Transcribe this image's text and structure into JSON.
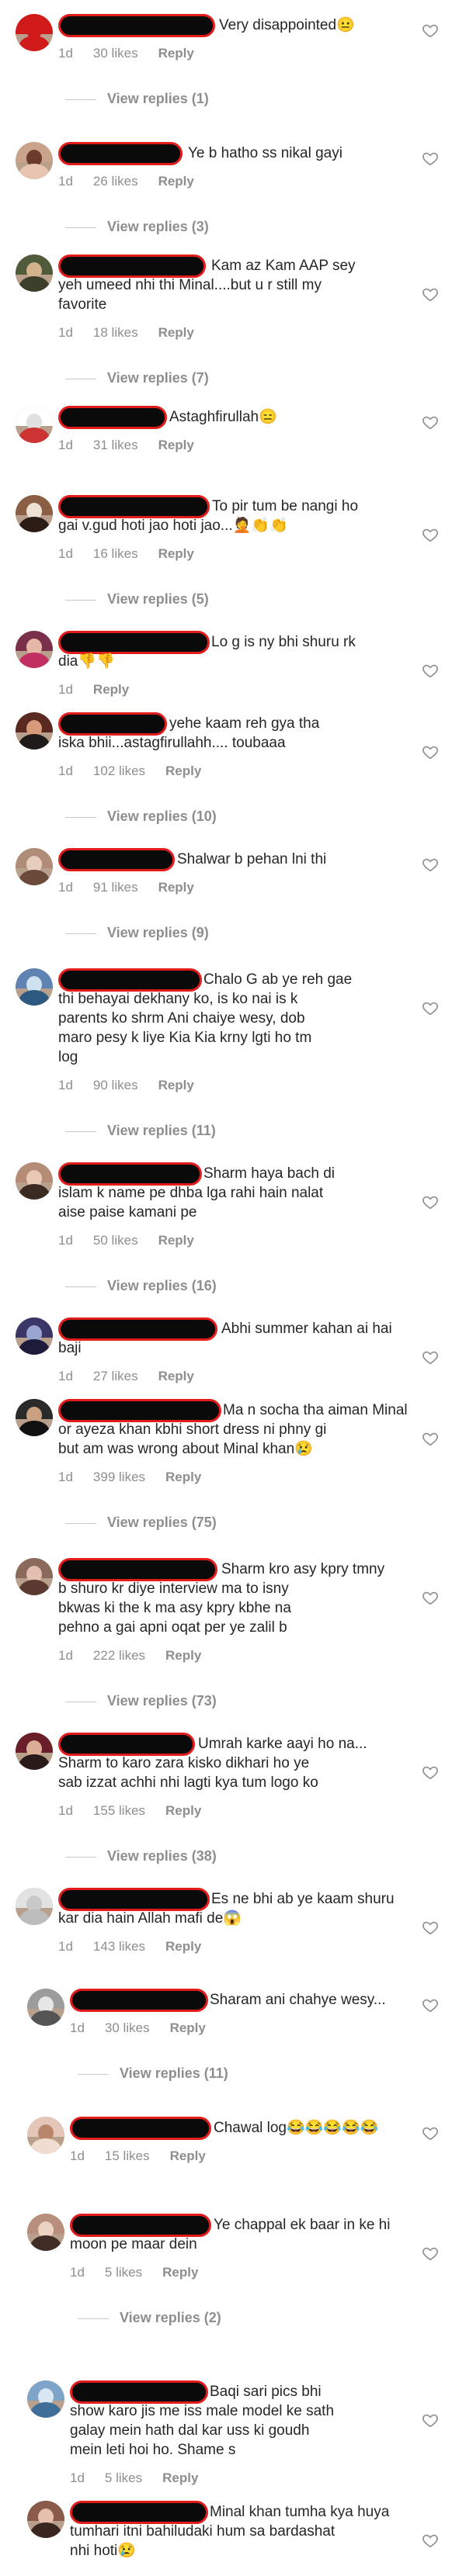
{
  "comments": [
    {
      "text": "Very disappointed",
      "time": "1d",
      "likes": "30 likes",
      "reply": "Reply",
      "view_replies": "View replies (1)",
      "emoji": "😐"
    },
    {
      "text": "Ye b hatho ss nikal gayi",
      "time": "1d",
      "likes": "26 likes",
      "reply": "Reply",
      "view_replies": "View replies (3)"
    },
    {
      "text": "Kam az Kam AAP sey\nyeh umeed nhi thi Minal....but u r still my\nfavorite",
      "time": "1d",
      "likes": "18 likes",
      "reply": "Reply",
      "view_replies": "View replies (7)"
    },
    {
      "text": "Astaghfirullah",
      "time": "1d",
      "likes": "31 likes",
      "reply": "Reply",
      "emoji": "😑"
    },
    {
      "text": "To pir tum be nangi ho\ngai v.gud hoti jao hoti jao...",
      "time": "1d",
      "likes": "16 likes",
      "reply": "Reply",
      "view_replies": "View replies (5)",
      "emoji": "🤦👏👏"
    },
    {
      "text": "Lo g is ny bhi shuru rk\ndia",
      "time": "1d",
      "likes": "",
      "reply": "Reply",
      "emoji": "👎👎"
    },
    {
      "text": "yehe kaam reh gya tha\niska bhii...astagfirullahh.... toubaaa",
      "time": "1d",
      "likes": "102 likes",
      "reply": "Reply",
      "view_replies": "View replies (10)"
    },
    {
      "text": "Shalwar b pehan lni thi",
      "time": "1d",
      "likes": "91 likes",
      "reply": "Reply",
      "view_replies": "View replies (9)"
    },
    {
      "text": "Chalo G ab ye reh gae\nthi behayai dekhany ko, is ko nai is k\nparents ko shrm Ani chaiye wesy, dob\nmaro pesy k liye Kia Kia krny lgti ho tm\nlog",
      "time": "1d",
      "likes": "90 likes",
      "reply": "Reply",
      "view_replies": "View replies (11)"
    },
    {
      "text": "Sharm haya bach di\nislam k name pe dhba lga rahi hain nalat\naise paise kamani pe",
      "time": "1d",
      "likes": "50 likes",
      "reply": "Reply",
      "view_replies": "View replies (16)"
    },
    {
      "text": "Abhi summer kahan ai hai\nbaji",
      "time": "1d",
      "likes": "27 likes",
      "reply": "Reply"
    },
    {
      "text": "Ma n socha tha aiman Minal\nor ayeza khan kbhi short dress ni phny gi\nbut am was wrong about Minal khan",
      "time": "1d",
      "likes": "399 likes",
      "reply": "Reply",
      "view_replies": "View replies (75)",
      "emoji": "😢"
    },
    {
      "text": "Sharm kro asy kpry tmny\nb shuro kr diye interview ma to isny\nbkwas ki the k ma asy kpry kbhe na\npehno a gai apni oqat per ye zalil b",
      "time": "1d",
      "likes": "222 likes",
      "reply": "Reply",
      "view_replies": "View replies (73)"
    },
    {
      "text": "Umrah karke aayi ho na...\nSharm to karo zara kisko dikhari ho ye\nsab izzat achhi nhi lagti kya tum logo ko",
      "time": "1d",
      "likes": "155 likes",
      "reply": "Reply",
      "view_replies": "View replies (38)"
    },
    {
      "text": "Es ne bhi ab ye kaam shuru\nkar dia hain Allah mafi de",
      "time": "1d",
      "likes": "143 likes",
      "reply": "Reply",
      "emoji": "😱"
    },
    {
      "text": "Sharam ani chahye wesy...",
      "time": "1d",
      "likes": "30 likes",
      "reply": "Reply",
      "view_replies": "View replies (11)"
    },
    {
      "text": "Chawal log",
      "time": "1d",
      "likes": "15 likes",
      "reply": "Reply",
      "emoji": "😂😂😂😂😂"
    },
    {
      "text": "Ye chappal ek baar in ke hi\nmoon pe maar dein",
      "time": "1d",
      "likes": "5 likes",
      "reply": "Reply",
      "view_replies": "View replies (2)"
    },
    {
      "text": "Baqi sari pics bhi\nshow karo jis me iss male model ke sath\ngalay mein hath dal kar uss ki goudh\nmein leti hoi ho. Shame s",
      "time": "1d",
      "likes": "5 likes",
      "reply": "Reply"
    },
    {
      "text": "Minal khan tumha kya huya\ntumhari itni bahiludaki hum sa bardashat\nnhi hoti",
      "time": "",
      "likes": "",
      "reply": "",
      "emoji": "😢"
    }
  ]
}
